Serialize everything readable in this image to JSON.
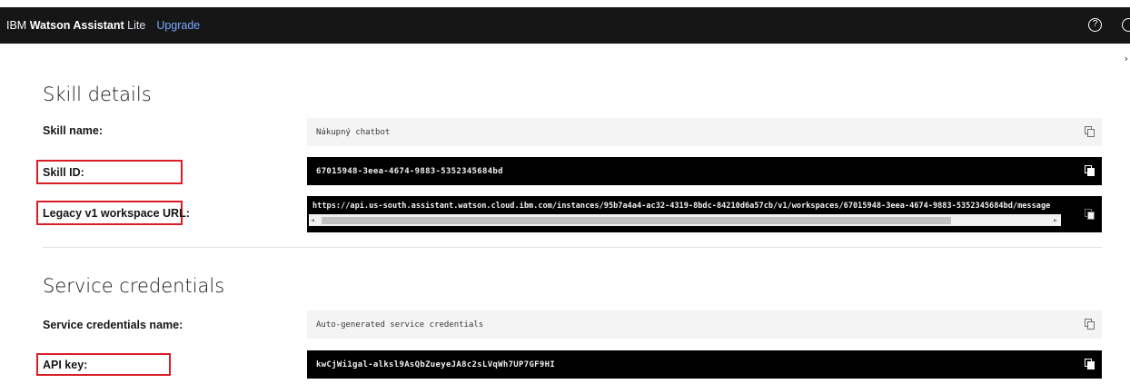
{
  "header": {
    "brand_prefix": "IBM",
    "brand_name": "Watson Assistant",
    "plan": "Lite",
    "upgrade_label": "Upgrade",
    "help_glyph": "?"
  },
  "icons": {
    "help": "help-circle-icon",
    "user": "user-avatar-icon",
    "copy": "copy-icon",
    "close": "chevron-right-icon"
  },
  "close_glyph": "›",
  "skill_details": {
    "title": "Skill details",
    "skill_name_label": "Skill name:",
    "skill_name_value": "Nákupný chatbot",
    "skill_id_label": "Skill ID:",
    "skill_id_value": "67015948-3eea-4674-9883-5352345684bd",
    "legacy_url_label": "Legacy v1 workspace URL:",
    "legacy_url_value": "https://api.us-south.assistant.watson.cloud.ibm.com/instances/95b7a4a4-ac32-4319-8bdc-84210d6a57cb/v1/workspaces/67015948-3eea-4674-9883-5352345684bd/message",
    "scroll_left_glyph": "◂",
    "scroll_right_glyph": "▸"
  },
  "service_credentials": {
    "title": "Service credentials",
    "credentials_name_label": "Service credentials name:",
    "credentials_name_value": "Auto-generated service credentials",
    "api_key_label": "API key:",
    "api_key_value": "kwCjWi1gal-alksl9AsQbZueyeJA8c2sLVqWh7UP7GF9HI"
  },
  "colors": {
    "topbar": "#161616",
    "accent_link": "#78a9ff",
    "highlight_box": "#da1e28",
    "secret_field_bg": "#000000",
    "field_bg": "#f4f4f4"
  }
}
